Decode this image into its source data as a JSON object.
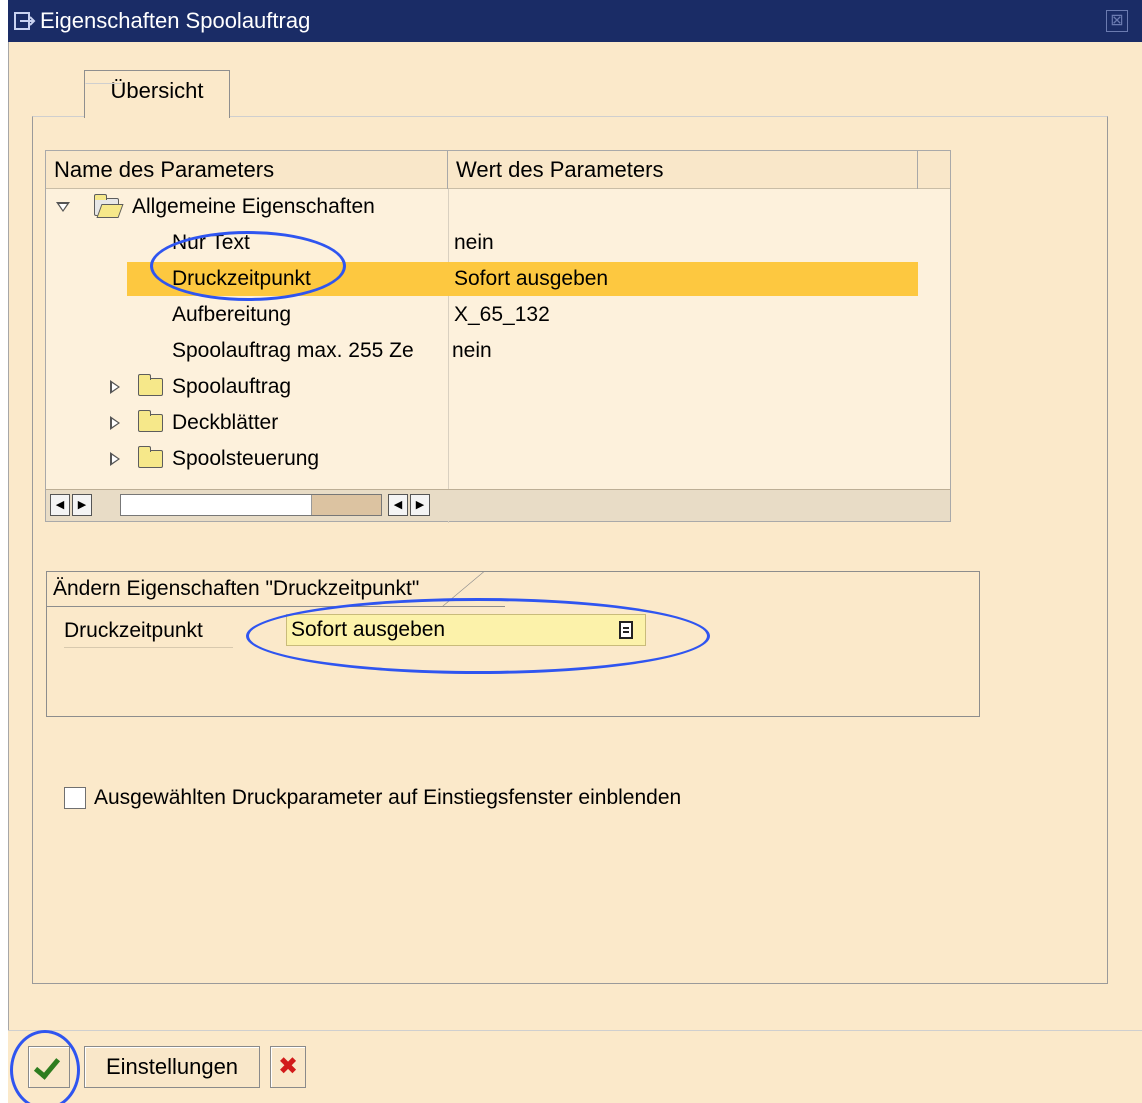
{
  "window": {
    "title": "Eigenschaften Spoolauftrag",
    "close_glyph": "⊠"
  },
  "tabs": [
    {
      "label": "Übersicht"
    }
  ],
  "tree": {
    "headers": {
      "name": "Name des Parameters",
      "value": "Wert des Parameters"
    },
    "rows": [
      {
        "name": "Allgemeine Eigenschaften",
        "value": "",
        "expanded": true,
        "type": "folder"
      },
      {
        "name": "Nur Text",
        "value": "nein",
        "type": "leaf"
      },
      {
        "name": "Druckzeitpunkt",
        "value": "Sofort ausgeben",
        "type": "leaf",
        "selected": true
      },
      {
        "name": "Aufbereitung",
        "value": "X_65_132",
        "type": "leaf"
      },
      {
        "name": "Spoolauftrag max. 255 Ze",
        "value": "nein",
        "type": "leaf"
      },
      {
        "name": "Spoolauftrag",
        "value": "",
        "expanded": false,
        "type": "folder"
      },
      {
        "name": "Deckblätter",
        "value": "",
        "expanded": false,
        "type": "folder"
      },
      {
        "name": "Spoolsteuerung",
        "value": "",
        "expanded": false,
        "type": "folder"
      }
    ]
  },
  "edit_group": {
    "title": "Ändern Eigenschaften \"Druckzeitpunkt\"",
    "field_label": "Druckzeitpunkt",
    "field_value": "Sofort ausgeben"
  },
  "checkbox": {
    "label": "Ausgewählten Druckparameter auf Einstiegsfenster einblenden",
    "checked": false
  },
  "buttons": {
    "settings": "Einstellungen",
    "cancel_glyph": "✖"
  },
  "colors": {
    "titlebar": "#1a2c66",
    "background": "#fbe9ca",
    "selection": "#fdc840",
    "dropdown": "#fcf2aa",
    "annotation": "#2f55f0"
  }
}
